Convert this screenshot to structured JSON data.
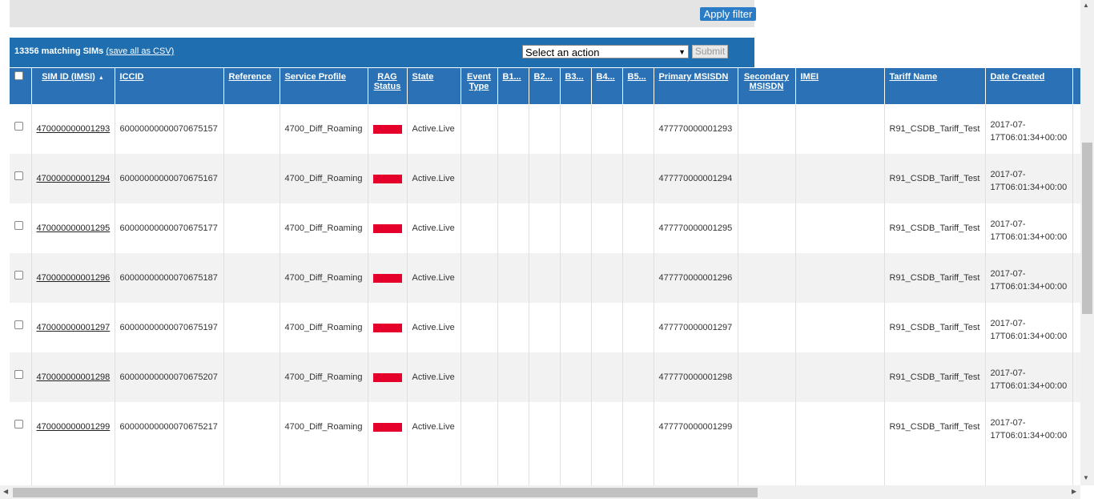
{
  "filter": {
    "apply_label": "Apply filter"
  },
  "actions": {
    "match_count": "13356 matching SIMs",
    "csv_link": "(save all as CSV)",
    "select_value": "Select an action",
    "submit_label": "Submit"
  },
  "columns": {
    "sim_id": "SIM ID (IMSI)",
    "iccid": "ICCID",
    "reference": "Reference",
    "service_profile": "Service Profile",
    "rag_l1": "RAG",
    "rag_l2": "Status",
    "state": "State",
    "event_l1": "Event",
    "event_l2": "Type",
    "b1": "B1...",
    "b2": "B2...",
    "b3": "B3...",
    "b4": "B4...",
    "b5": "B5...",
    "primary_msisdn": "Primary MSISDN",
    "secondary_l1": "Secondary",
    "secondary_l2": "MSISDN",
    "imei": "IMEI",
    "tariff": "Tariff Name",
    "date_created": "Date Created"
  },
  "rag_color": "#e4002b",
  "rows": [
    {
      "sim": "470000000001293",
      "iccid": "600000000000706751​57",
      "profile": "4700_Diff_Roaming",
      "state": "Active.Live",
      "msisdn": "477770000001293",
      "tariff": "R91_CSDB_Tariff_Test",
      "date_l1": "2017-07-",
      "date_l2": "17T06:01:34+00:00"
    },
    {
      "sim": "470000000001294",
      "iccid": "60000000000070675167",
      "profile": "4700_Diff_Roaming",
      "state": "Active.Live",
      "msisdn": "477770000001294",
      "tariff": "R91_CSDB_Tariff_Test",
      "date_l1": "2017-07-",
      "date_l2": "17T06:01:34+00:00"
    },
    {
      "sim": "470000000001295",
      "iccid": "60000000000070675177",
      "profile": "4700_Diff_Roaming",
      "state": "Active.Live",
      "msisdn": "477770000001295",
      "tariff": "R91_CSDB_Tariff_Test",
      "date_l1": "2017-07-",
      "date_l2": "17T06:01:34+00:00"
    },
    {
      "sim": "470000000001296",
      "iccid": "60000000000070675187",
      "profile": "4700_Diff_Roaming",
      "state": "Active.Live",
      "msisdn": "477770000001296",
      "tariff": "R91_CSDB_Tariff_Test",
      "date_l1": "2017-07-",
      "date_l2": "17T06:01:34+00:00"
    },
    {
      "sim": "470000000001297",
      "iccid": "60000000000070675197",
      "profile": "4700_Diff_Roaming",
      "state": "Active.Live",
      "msisdn": "477770000001297",
      "tariff": "R91_CSDB_Tariff_Test",
      "date_l1": "2017-07-",
      "date_l2": "17T06:01:34+00:00"
    },
    {
      "sim": "470000000001298",
      "iccid": "60000000000070675207",
      "profile": "4700_Diff_Roaming",
      "state": "Active.Live",
      "msisdn": "477770000001298",
      "tariff": "R91_CSDB_Tariff_Test",
      "date_l1": "2017-07-",
      "date_l2": "17T06:01:34+00:00"
    },
    {
      "sim": "470000000001299",
      "iccid": "60000000000070675217",
      "profile": "4700_Diff_Roaming",
      "state": "Active.Live",
      "msisdn": "477770000001299",
      "tariff": "R91_CSDB_Tariff_Test",
      "date_l1": "2017-07-",
      "date_l2": "17T06:01:34+00:00"
    }
  ]
}
